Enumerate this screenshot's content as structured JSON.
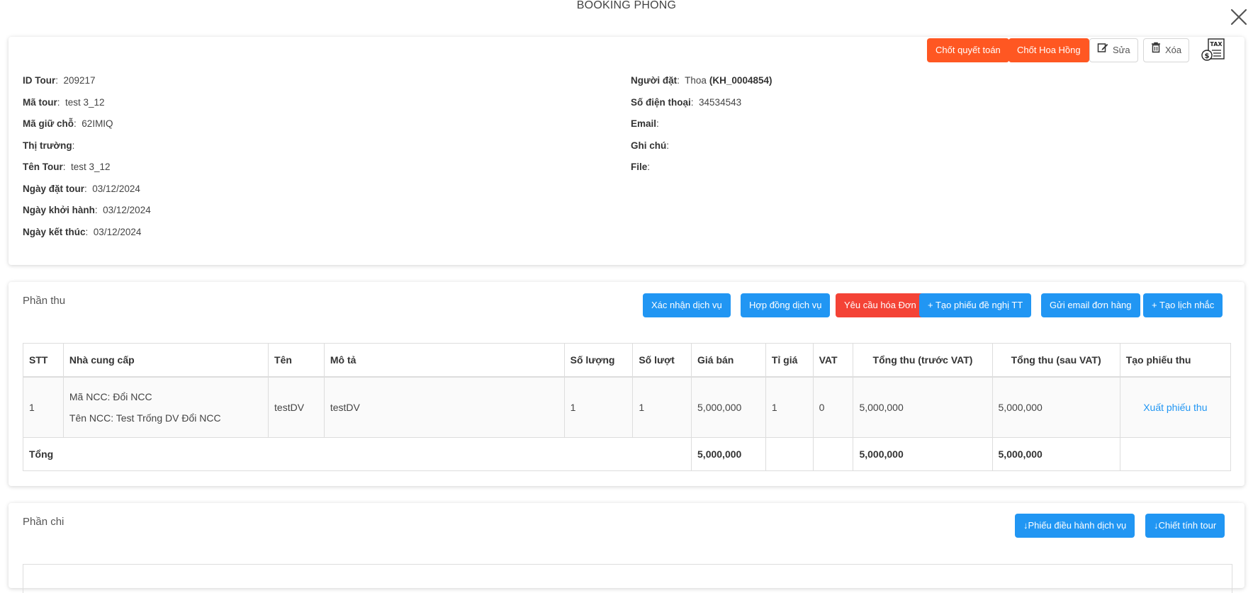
{
  "modal": {
    "title": "BOOKING PHÒNG"
  },
  "actions": {
    "chot_quyet_toan": "Chốt quyết toán",
    "chot_hoa_hong": "Chốt Hoa Hồng",
    "sua": "Sửa",
    "xoa": "Xóa",
    "tax_icon_text": "TAX"
  },
  "info_left": [
    {
      "label": "ID Tour",
      "value": "209217"
    },
    {
      "label": "Mã tour",
      "value": "test 3_12"
    },
    {
      "label": "Mã giữ chỗ",
      "value": "62IMIQ"
    },
    {
      "label": "Thị trường",
      "value": ""
    },
    {
      "label": "Tên Tour",
      "value": "test 3_12"
    },
    {
      "label": "Ngày đặt tour",
      "value": "03/12/2024"
    },
    {
      "label": "Ngày khởi hành",
      "value": "03/12/2024"
    },
    {
      "label": "Ngày kết thúc",
      "value": "03/12/2024"
    }
  ],
  "info_right": [
    {
      "label": "Người đặt",
      "value": "Thoa",
      "extra": "(KH_0004854)"
    },
    {
      "label": "Số điện thoại",
      "value": "34534543"
    },
    {
      "label": "Email",
      "value": ""
    },
    {
      "label": "Ghi chú",
      "value": ""
    },
    {
      "label": "File",
      "value": ""
    }
  ],
  "phan_thu": {
    "title": "Phần thu",
    "buttons": {
      "xac_nhan": "Xác nhận dịch vụ",
      "hop_dong": "Hợp đồng dịch vụ",
      "yeu_cau_hoa_don": "Yêu cầu hóa Đơn",
      "tao_phieu": "+ Tạo phiếu đề nghị TT",
      "gui_email": "Gửi email đơn hàng",
      "tao_lich_nhac": "+ Tạo lịch nhắc"
    },
    "columns": [
      "STT",
      "Nhà cung cấp",
      "Tên",
      "Mô tả",
      "Số lượng",
      "Số lượt",
      "Giá bán",
      "Tỉ giá",
      "VAT",
      "Tổng thu (trước VAT)",
      "Tổng thu (sau VAT)",
      "Tạo phiếu thu"
    ],
    "row": {
      "stt": "1",
      "ma_ncc": "Mã NCC: Đổi NCC",
      "ten_ncc": "Tên NCC: Test Trống DV Đổi NCC",
      "ten": "testDV",
      "mo_ta": "testDV",
      "so_luong": "1",
      "so_luot": "1",
      "gia_ban": "5,000,000",
      "ti_gia": "1",
      "vat": "0",
      "tong_truoc": "5,000,000",
      "tong_sau": "5,000,000",
      "link": "Xuất phiếu thu"
    },
    "total": {
      "label": "Tổng",
      "gia_ban": "5,000,000",
      "tong_truoc": "5,000,000",
      "tong_sau": "5,000,000"
    }
  },
  "phan_chi": {
    "title": "Phần chi",
    "buttons": {
      "phieu_dieu_hanh": "↓Phiếu điều hành dịch vụ",
      "chiet_tinh": "↓Chiết tính tour"
    }
  }
}
